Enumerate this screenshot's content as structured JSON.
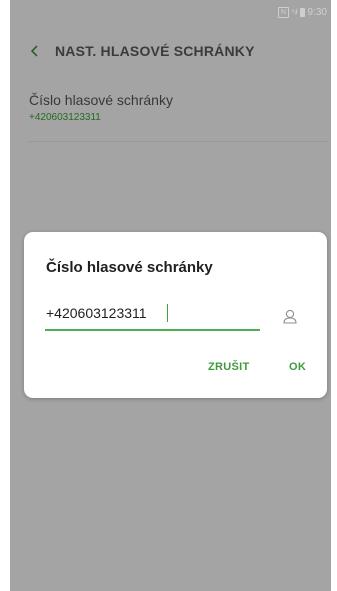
{
  "status_bar": {
    "nfc": "N",
    "signal": "ᵗᵗ .ıl",
    "time": "9:30"
  },
  "app_bar": {
    "back_icon": "chevron-left-icon",
    "title": "NAST. HLASOVÉ SCHRÁNKY"
  },
  "setting": {
    "title": "Číslo hlasové schránky",
    "value": "+420603123311"
  },
  "dialog": {
    "title": "Číslo hlasové schránky",
    "input_value": "+420603123311",
    "contact_icon": "person-icon",
    "cancel_label": "ZRUŠIT",
    "ok_label": "OK"
  },
  "colors": {
    "accent": "#4caf50",
    "button_text": "#3e9b3e",
    "dim_background": "#a4a4a4"
  }
}
